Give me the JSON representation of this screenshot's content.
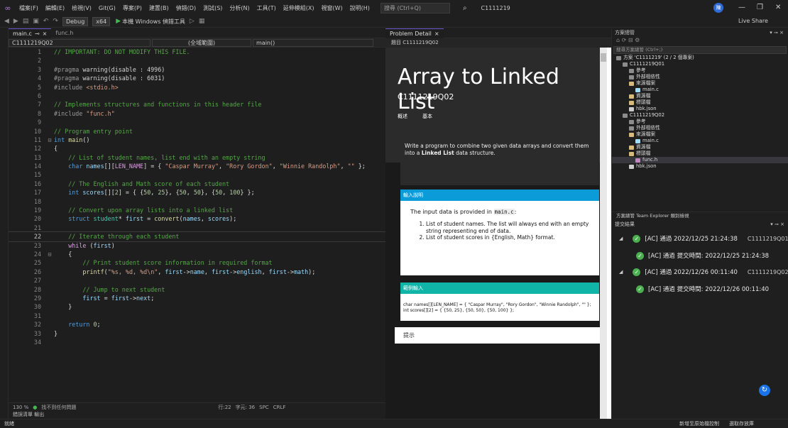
{
  "titlebar": {
    "menus": [
      "檔案(F)",
      "編輯(E)",
      "檢視(V)",
      "Git(G)",
      "專案(P)",
      "建置(B)",
      "偵錯(D)",
      "測試(S)",
      "分析(N)",
      "工具(T)",
      "延伸模組(X)",
      "視窗(W)",
      "說明(H)"
    ],
    "search_placeholder": "搜尋 (Ctrl+Q)",
    "project_name": "C1111219",
    "avatar": "陳",
    "live_share": "Live Share"
  },
  "toolbar": {
    "config": "Debug",
    "platform": "x64",
    "run_label": "本機 Windows 偵錯工具"
  },
  "editor": {
    "tabs": [
      {
        "label": "main.c",
        "active": true
      },
      {
        "label": "func.h",
        "active": false
      }
    ],
    "nav_project": "C1111219Q02",
    "nav_scope": "(全域範圍)",
    "nav_member": "main()",
    "current_line": 22,
    "lines": [
      "// IMPORTANT: DO NOT MODIFY THIS FILE.",
      "",
      "#pragma warning(disable : 4996)",
      "#pragma warning(disable : 6031)",
      "#include <stdio.h>",
      "",
      "// Implements structures and functions in this header file",
      "#include \"func.h\"",
      "",
      "// Program entry point",
      "int main()",
      "{",
      "    // List of student names, list end with an empty string",
      "    char names[][LEN_NAME] = { \"Caspar Murray\", \"Rory Gordon\", \"Winnie Randolph\", \"\" };",
      "",
      "    // The English and Math score of each student",
      "    int scores[][2] = { {50, 25}, {50, 50}, {50, 100} };",
      "",
      "    // Convert upon array lists into a linked list",
      "    struct student* first = convert(names, scores);",
      "",
      "    // Iterate through each student",
      "    while (first)",
      "    {",
      "        // Print student score information in required format",
      "        printf(\"%s, %d, %d\\n\", first->name, first->english, first->math);",
      "",
      "        // Jump to next student",
      "        first = first->next;",
      "    }",
      "",
      "    return 0;",
      "}",
      ""
    ],
    "zoom": "130 %",
    "issues": "找不到任何問題",
    "cursor": "行:22",
    "column": "字元: 36",
    "spacing": "SPC",
    "eol": "CRLF",
    "bottom_tabs": "錯誤清單  輸出"
  },
  "problem": {
    "tab_label": "Problem Detail",
    "subtitle": "題目 C1111219Q02",
    "title": "Array to Linked List",
    "id": "C1111219Q02",
    "tab_overview": "概述",
    "tab_basic": "基本",
    "desc_pre": "Write a program to combine two given data arrays and convert them into a ",
    "desc_bold": "Linked List",
    "desc_post": " data structure.",
    "input_header": "輸入說明",
    "input_intro": "The input data is provided in ",
    "input_file": "main.c",
    "input_items": [
      "List of student names. The list will always end with an empty string representing end of data.",
      "List of student scores in {English, Math} format."
    ],
    "sample_header": "範例輸入",
    "sample_line1": "char names[][LEN_NAME] = { \"Caspar Murray\", \"Rory Gordon\", \"Winnie Randolph\", \"\" };",
    "sample_line2": "int scores[][2] = { {50, 25}, {50, 50}, {50, 100} };",
    "hint": "提示"
  },
  "solution": {
    "header": "方案總管",
    "search": "搜尋方案總管 (Ctrl+;)",
    "items": [
      {
        "label": "方案 'C1111219' (2 / 2 個專案)",
        "indent": 0,
        "color": "#8c8c8c"
      },
      {
        "label": "C1111219Q01",
        "indent": 1,
        "color": "#8c8c8c"
      },
      {
        "label": "參考",
        "indent": 2,
        "color": "#8c8c8c"
      },
      {
        "label": "外部相依性",
        "indent": 2,
        "color": "#8c8c8c"
      },
      {
        "label": "來源檔案",
        "indent": 2,
        "color": "#d7ba7d"
      },
      {
        "label": "main.c",
        "indent": 3,
        "color": "#9cdcfe"
      },
      {
        "label": "資源檔",
        "indent": 2,
        "color": "#d7ba7d"
      },
      {
        "label": "標頭檔",
        "indent": 2,
        "color": "#d7ba7d"
      },
      {
        "label": "hbk.json",
        "indent": 2,
        "color": "#cccccc"
      },
      {
        "label": "C1111219Q02",
        "indent": 1,
        "color": "#8c8c8c"
      },
      {
        "label": "參考",
        "indent": 2,
        "color": "#8c8c8c"
      },
      {
        "label": "外部相依性",
        "indent": 2,
        "color": "#8c8c8c"
      },
      {
        "label": "來源檔案",
        "indent": 2,
        "color": "#d7ba7d"
      },
      {
        "label": "main.c",
        "indent": 3,
        "color": "#9cdcfe"
      },
      {
        "label": "資源檔",
        "indent": 2,
        "color": "#d7ba7d"
      },
      {
        "label": "標頭檔",
        "indent": 2,
        "color": "#d7ba7d"
      },
      {
        "label": "func.h",
        "indent": 3,
        "color": "#c586c0",
        "selected": true
      },
      {
        "label": "hbk.json",
        "indent": 2,
        "color": "#cccccc"
      }
    ],
    "bottom_tabs": "方案總管  Team Explorer  類別檢視"
  },
  "results": {
    "header": "提交結果",
    "entries": [
      {
        "text": "[AC] 通過 2022/12/25 21:24:38",
        "code": "C1111219Q01"
      },
      {
        "text": "[AC] 通過 提交時間: 2022/12/25 21:24:38",
        "code": ""
      },
      {
        "text": "[AC] 通過 2022/12/26 00:11:40",
        "code": "C1111219Q02"
      },
      {
        "text": "[AC] 通過 提交時間: 2022/12/26 00:11:40",
        "code": ""
      }
    ]
  },
  "statusbar": {
    "left": "就緒",
    "right1": "新增至原始檔控制",
    "right2": "選取存放庫"
  }
}
